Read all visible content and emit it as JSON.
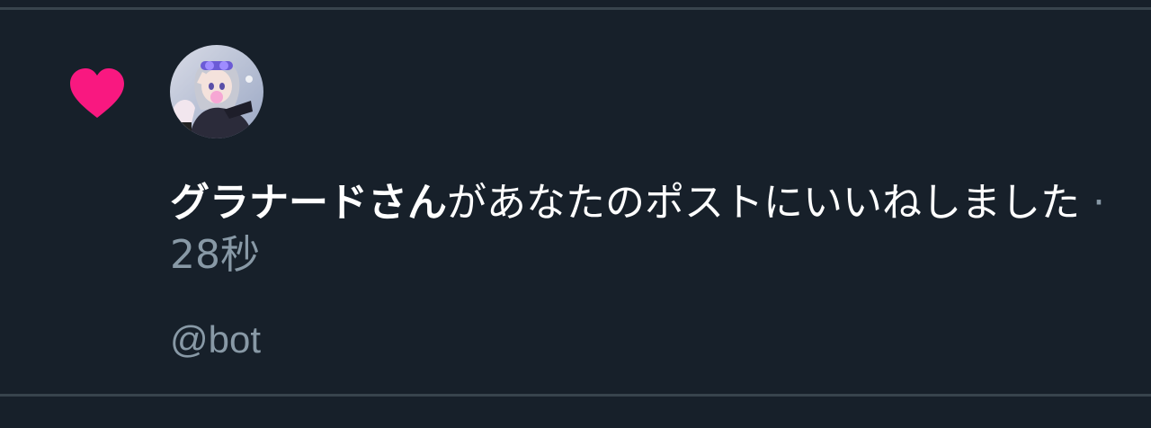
{
  "notification": {
    "type_icon": "heart-icon",
    "icon_color": "#f91880",
    "avatar_icon": "avatar",
    "user_name": "グラナードさん",
    "action_text": "があなたのポストにいいねしました",
    "separator": "·",
    "time_ago": "28秒",
    "handle": "@bot"
  },
  "colors": {
    "background": "#17202a",
    "divider": "#38444d",
    "secondary_text": "#8899a6",
    "primary_text": "#ffffff"
  }
}
